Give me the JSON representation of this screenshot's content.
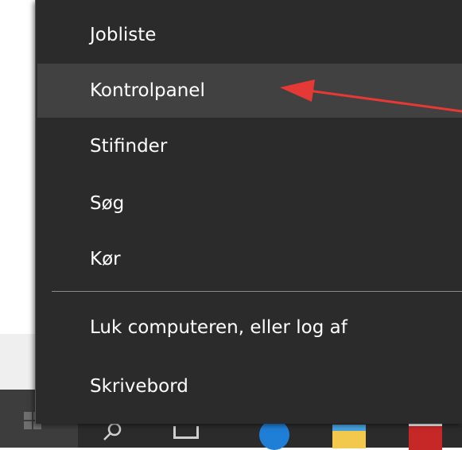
{
  "context_menu": {
    "items": [
      {
        "label": "Jobliste"
      },
      {
        "label": "Kontrolpanel"
      },
      {
        "label": "Stifinder"
      },
      {
        "label": "Søg"
      },
      {
        "label": "Kør"
      },
      {
        "label": "Luk computeren, eller log af"
      },
      {
        "label": "Skrivebord"
      }
    ],
    "highlighted_item": "Kontrolpanel"
  },
  "taskbar": {
    "icons": [
      "windows-start-icon",
      "search-icon",
      "task-view-icon",
      "edge-icon",
      "file-explorer-icon",
      "chrome-icon"
    ]
  },
  "annotation": {
    "arrow_color": "#e53935",
    "points_to": "Kontrolpanel"
  },
  "colors": {
    "menu_background": "#2b2b2b",
    "menu_hover": "#414141",
    "menu_text": "#ffffff",
    "taskbar_background": "#2b2b2b"
  }
}
